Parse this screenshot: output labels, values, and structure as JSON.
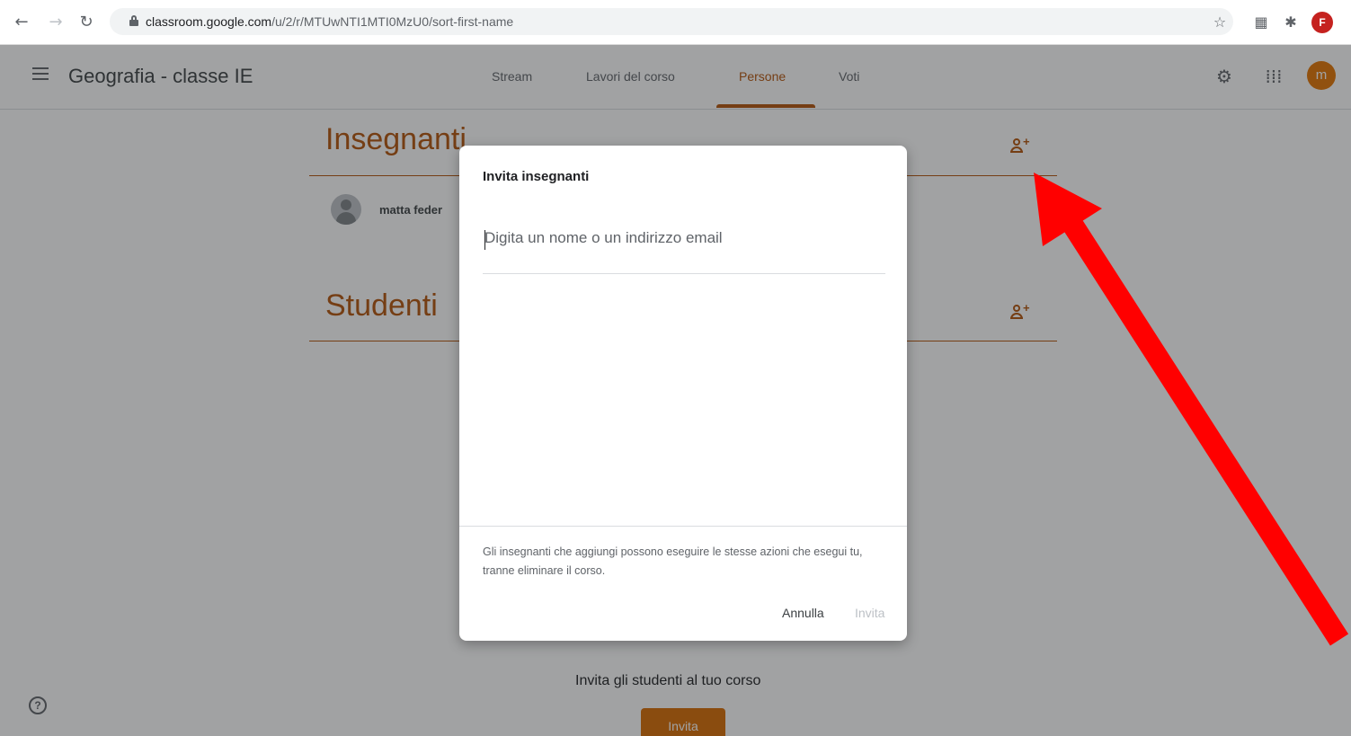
{
  "browser": {
    "url_domain": "classroom.google.com",
    "url_path": "/u/2/r/MTUwNTI1MTI0MzU0/sort-first-name",
    "profile_initial": "F"
  },
  "header": {
    "course_title": "Geografia - classe IE",
    "tabs": [
      {
        "label": "Stream",
        "active": false
      },
      {
        "label": "Lavori del corso",
        "active": false
      },
      {
        "label": "Persone",
        "active": true
      },
      {
        "label": "Voti",
        "active": false
      }
    ],
    "avatar_initial": "m"
  },
  "page": {
    "teachers_heading": "Insegnanti",
    "teacher_name": "matta feder",
    "students_heading": "Studenti",
    "invite_students_text": "Invita gli studenti al tuo corso",
    "invite_students_button": "Invita"
  },
  "dialog": {
    "title": "Invita insegnanti",
    "input_placeholder": "Digita un nome o un indirizzo email",
    "input_value": "",
    "note": "Gli insegnanti che aggiungi possono eseguire le stesse azioni che esegui tu, tranne eliminare il corso.",
    "cancel_label": "Annulla",
    "invite_label": "Invita"
  },
  "colors": {
    "accent": "#b45309",
    "annotation_arrow": "#ff0000"
  }
}
